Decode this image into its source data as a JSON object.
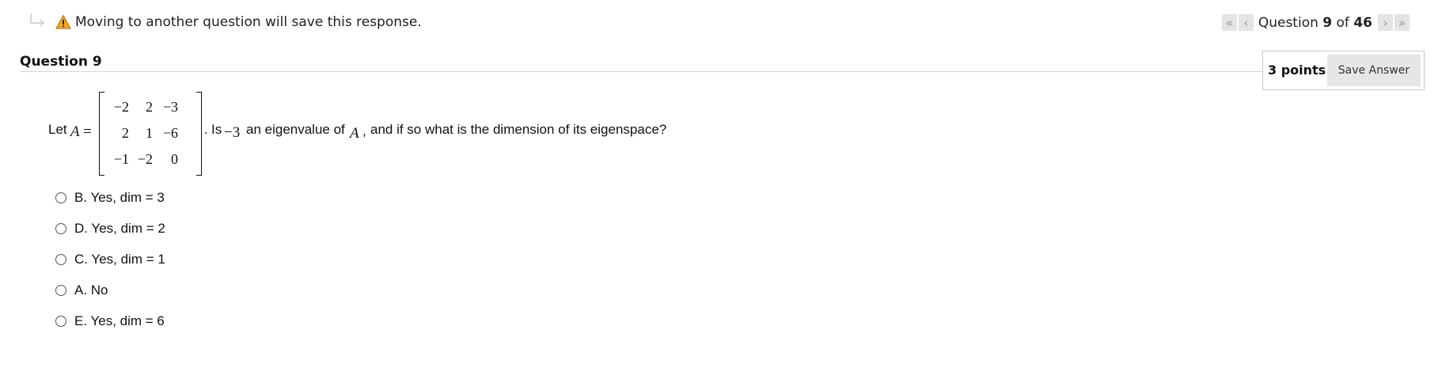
{
  "warning": {
    "text": "Moving to another question will save this response."
  },
  "navigation": {
    "first_icon": "«",
    "prev_icon": "‹",
    "next_icon": "›",
    "last_icon": "»",
    "prefix": "Question",
    "current": "9",
    "separator": "of",
    "total": "46"
  },
  "question": {
    "header": "Question 9",
    "points": "3 points",
    "save_label": "Save Answer",
    "prompt": {
      "let": "Let",
      "matrix_name": "A",
      "equals": "=",
      "matrix": [
        [
          "−2",
          "2",
          "−3"
        ],
        [
          "2",
          "1",
          "−6"
        ],
        [
          "−1",
          "−2",
          "0"
        ]
      ],
      "period": ".",
      "is": "Is",
      "eigen_value": "−3",
      "middle": "an eigenvalue of",
      "ref": "A",
      "comma": ",",
      "tail": "and if so what is the dimension of its eigenspace?"
    },
    "options": [
      {
        "label": "B. Yes, dim = 3"
      },
      {
        "label": "D. Yes, dim = 2"
      },
      {
        "label": "C. Yes, dim = 1"
      },
      {
        "label": "A. No"
      },
      {
        "label": "E. Yes, dim = 6"
      }
    ]
  },
  "colors": {
    "accent_warning": "#f5a623",
    "button_bg": "#e6e6e6",
    "divider": "#d4d4d4"
  }
}
